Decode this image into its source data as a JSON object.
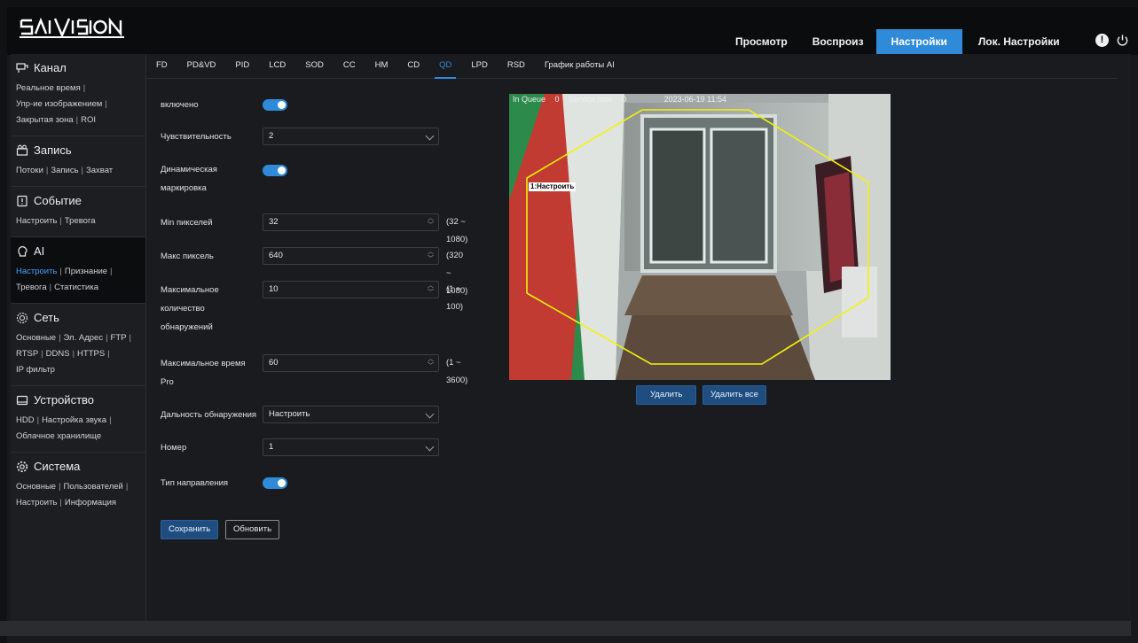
{
  "brand": {
    "logo_text": "SATVISION"
  },
  "nav": {
    "items": [
      "Просмотр",
      "Воспроиз",
      "Настройки",
      "Лок. Настройки"
    ],
    "active_index": 2
  },
  "sidebar": [
    {
      "title": "Канал",
      "icon": "channel-icon",
      "links": [
        "Реальное время",
        "Упр-ие изображением",
        "Закрытая зона",
        "ROI"
      ]
    },
    {
      "title": "Запись",
      "icon": "record-icon",
      "links": [
        "Потоки",
        "Запись",
        "Захват"
      ]
    },
    {
      "title": "Событие",
      "icon": "event-icon",
      "links": [
        "Настроить",
        "Тревога"
      ]
    },
    {
      "title": "AI",
      "icon": "ai-icon",
      "links": [
        "Настроить",
        "Признание",
        "Тревога",
        "Статистика"
      ],
      "active_link": 0
    },
    {
      "title": "Сеть",
      "icon": "network-icon",
      "links": [
        "Основные",
        "Эл. Адрес",
        "FTP",
        "RTSP",
        "DDNS",
        "HTTPS",
        "IP фильтр"
      ]
    },
    {
      "title": "Устройство",
      "icon": "device-icon",
      "links": [
        "HDD",
        "Настройка звука",
        "Облачное хранилище"
      ]
    },
    {
      "title": "Система",
      "icon": "system-icon",
      "links": [
        "Основные",
        "Пользователей",
        "Настроить",
        "Информация"
      ]
    }
  ],
  "tabs": {
    "items": [
      "FD",
      "PD&VD",
      "PID",
      "LCD",
      "SOD",
      "CC",
      "HM",
      "CD",
      "QD",
      "LPD",
      "RSD",
      "График работы AI"
    ],
    "active_index": 8
  },
  "form": {
    "enabled_label": "включено",
    "sensitivity_label": "Чувствительность",
    "sensitivity_value": "2",
    "dynamic_label_1": "Динамическая",
    "dynamic_label_2": "маркировка",
    "min_pixels_label": "Min пикселей",
    "min_pixels_value": "32",
    "min_pixels_range": "(32 ~ 1080)",
    "max_pixels_label": "Макс пиксель",
    "max_pixels_value": "640",
    "max_pixels_range": "(320 ~ 1080)",
    "max_detect_label_1": "Максимальное",
    "max_detect_label_2": "количество",
    "max_detect_label_3": "обнаружений",
    "max_detect_value": "10",
    "max_detect_range": "(1 ~ 100)",
    "max_time_label_1": "Максимальное время",
    "max_time_label_2": "Pro",
    "max_time_value": "60",
    "max_time_range": "(1 ~ 3600)",
    "range_label": "Дальность обнаружения",
    "range_value": "Настроить",
    "number_label": "Номер",
    "number_value": "1",
    "direction_label": "Тип направления",
    "save_button": "Сохранить",
    "refresh_button": "Обновить"
  },
  "camera": {
    "osd_queue": "In Queue",
    "osd_queue_count": "0",
    "osd_service": "Service time",
    "osd_service_count": "0",
    "osd_time": "2023-06-19 11:54",
    "zone_label": "1:Настроить",
    "delete_button": "Удалить",
    "delete_all_button": "Удалить все"
  }
}
